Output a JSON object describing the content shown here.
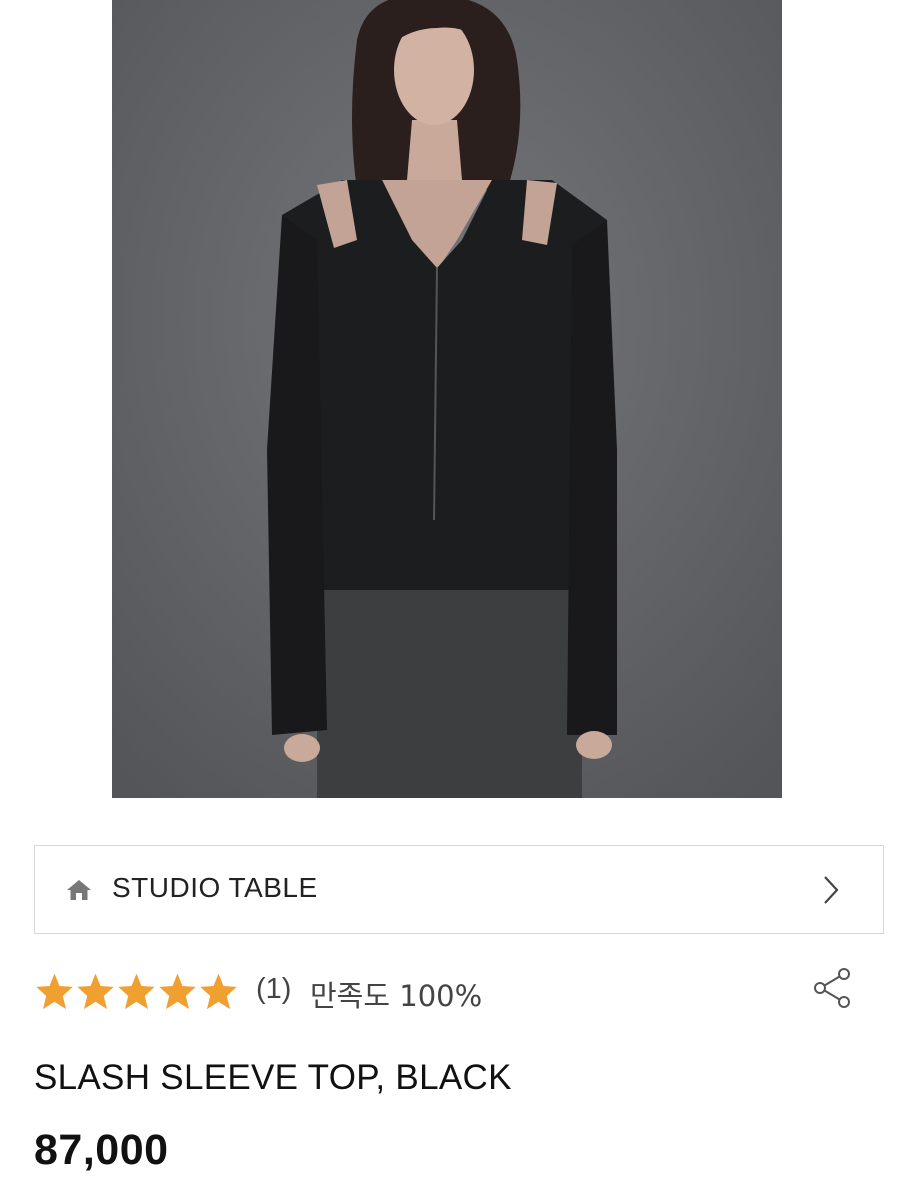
{
  "product_image": {
    "alt": "model wearing black slash sleeve top",
    "background_color": "#606164"
  },
  "brand": {
    "name": "STUDIO TABLE",
    "icon": "home-icon",
    "chevron": "chevron-right-icon"
  },
  "rating": {
    "stars": 5,
    "star_color": "#f0a030",
    "review_count": "(1)",
    "satisfaction": "만족도 100%",
    "share_icon": "share-icon"
  },
  "product": {
    "name": "SLASH SLEEVE TOP, BLACK",
    "price": "87,000"
  }
}
